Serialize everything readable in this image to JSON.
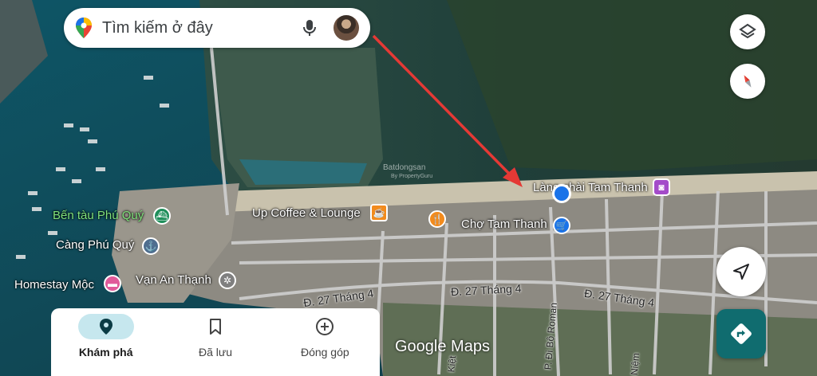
{
  "search": {
    "placeholder": "Tìm kiếm ở đây"
  },
  "places": {
    "ben_tau": "Bến tàu Phú Quý",
    "cang": "Càng Phú Quý",
    "homestay": "Homestay Mộc",
    "van_an_thanh": "Vạn An Thạnh",
    "up_coffee": "Up Coffee & Lounge",
    "cho": "Chợ Tam Thanh",
    "lang_chai": "Làng chài Tam Thanh"
  },
  "roads": {
    "road_left": "Đ. 27 Tháng 4",
    "road_mid": "Đ. 27 Tháng 4",
    "road_right": "Đ. 27 Tháng 4",
    "di_bo": "P. Đi Bộ Roman",
    "kiet": "Kiệt",
    "niem": "Niệm"
  },
  "watermark": {
    "text": "Batdongsan",
    "sub": "By PropertyGuru"
  },
  "brand": "Google Maps",
  "nav": [
    {
      "label": "Khám phá",
      "icon": "explore-pin-icon",
      "active": true
    },
    {
      "label": "Đã lưu",
      "icon": "bookmark-icon",
      "active": false
    },
    {
      "label": "Đóng góp",
      "icon": "add-circle-icon",
      "active": false
    }
  ],
  "colors": {
    "accent": "#106c6f",
    "location_dot": "#1a73e8",
    "arrow": "#e53935",
    "sea": "#0f4a5a",
    "vegetation": "#2f4a2c"
  }
}
